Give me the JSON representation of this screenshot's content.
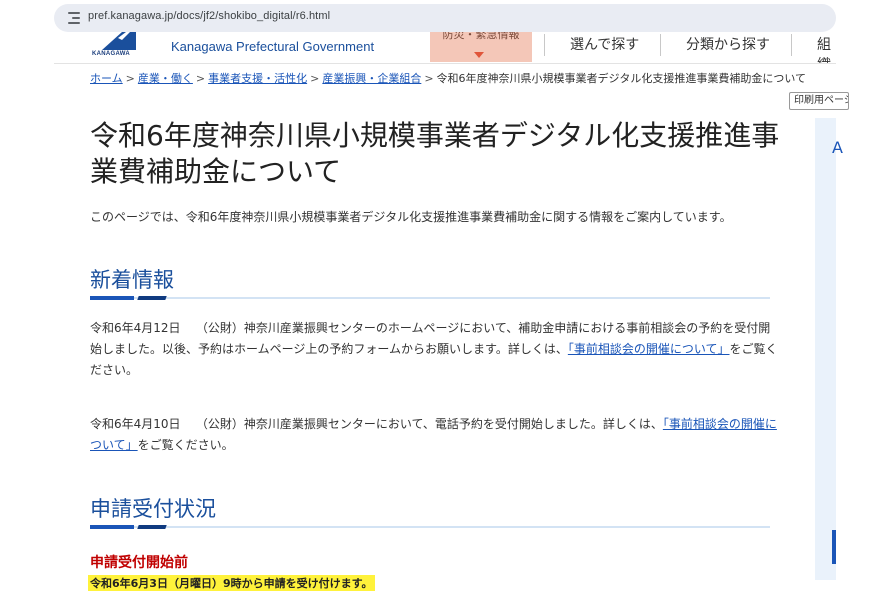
{
  "browser": {
    "url": "pref.kanagawa.jp/docs/jf2/shokibo_digital/r6.html"
  },
  "header": {
    "logo_text": "KANAGAWA",
    "gov_name": "Kanagawa Prefectural Government",
    "emergency_label": "防災・緊急情報",
    "nav": [
      "選んで探す",
      "分類から探す",
      "組織"
    ]
  },
  "breadcrumb": {
    "links": [
      "ホーム",
      "産業・働く",
      "事業者支援・活性化",
      "産業振興・企業組合"
    ],
    "current": "令和6年度神奈川県小規模事業者デジタル化支援推進事業費補助金について"
  },
  "print_label": "印刷用ページ",
  "sidebar": {
    "letter": "A"
  },
  "page": {
    "title": "令和6年度神奈川県小規模事業者デジタル化支援推進事業費補助金について",
    "intro": "このページでは、令和6年度神奈川県小規模事業者デジタル化支援推進事業費補助金に関する情報をご案内しています。"
  },
  "news": {
    "heading": "新着情報",
    "items": [
      {
        "date": "令和6年4月12日",
        "text": "（公財）神奈川産業振興センターのホームページにおいて、補助金申請における事前相談会の予約を受付開始しました。以後、予約はホームページ上の予約フォームからお願いします。詳しくは、",
        "link": "「事前相談会の開催について」",
        "suffix": "をご覧ください。"
      },
      {
        "date": "令和6年4月10日",
        "text": "（公財）神奈川産業振興センターにおいて、電話予約を受付開始しました。詳しくは、",
        "link": "「事前相談会の開催について」",
        "suffix": "をご覧ください。"
      }
    ]
  },
  "status": {
    "heading": "申請受付状況",
    "label": "申請受付開始前",
    "note": "令和6年6月3日（月曜日）9時から申請を受け付けます。"
  },
  "colors": {
    "link": "#1a55b8",
    "heading": "#1a4f9c",
    "status_red": "#c00000",
    "highlight": "#fff23b"
  }
}
